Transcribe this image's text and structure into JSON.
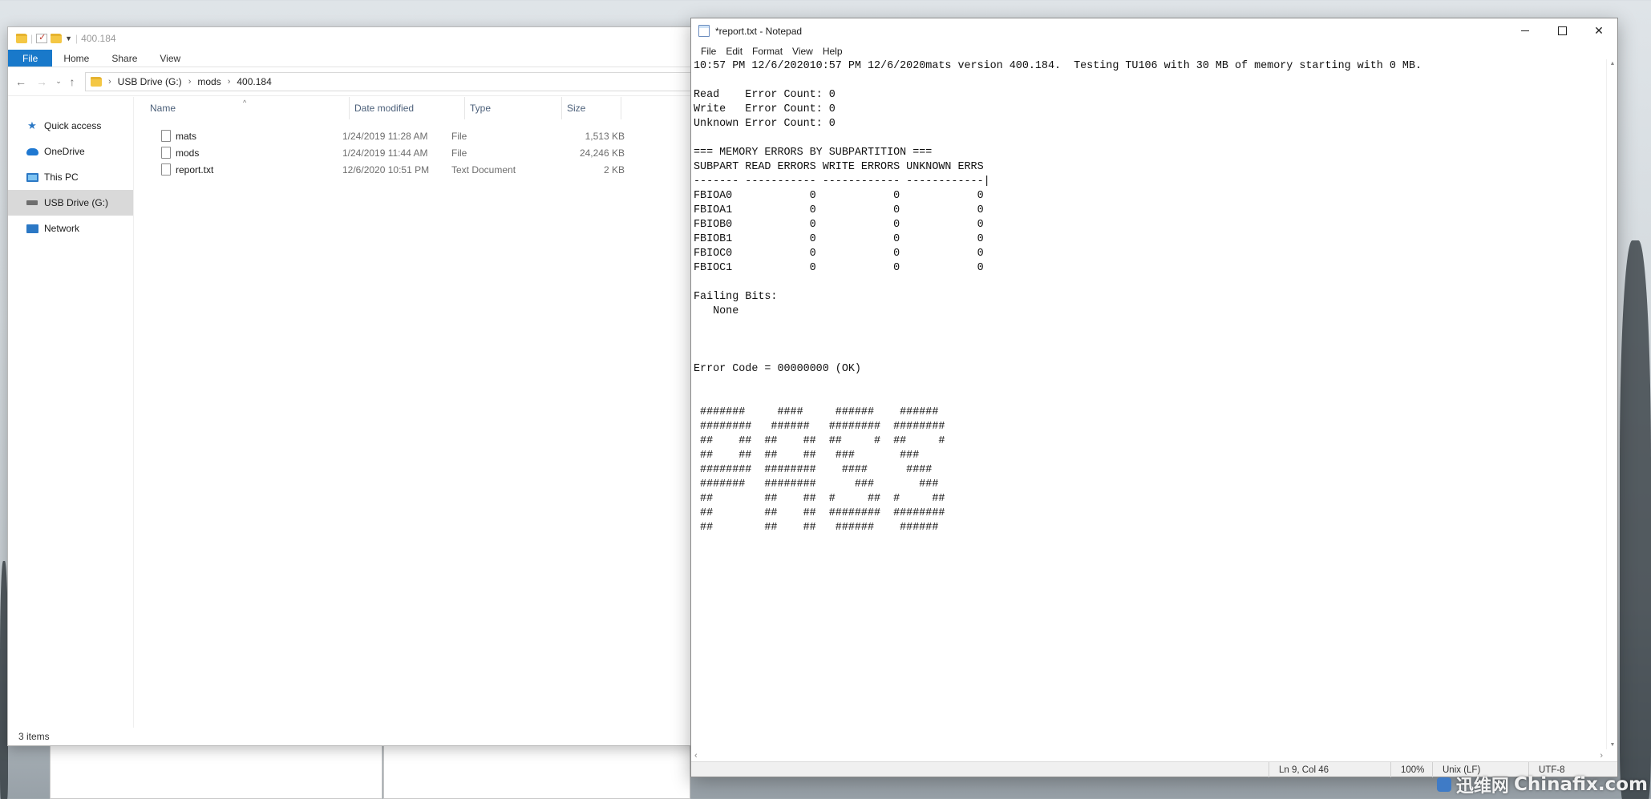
{
  "explorer": {
    "title_path": "400.184",
    "ribbon_tabs": [
      "File",
      "Home",
      "Share",
      "View"
    ],
    "breadcrumb": [
      "USB Drive (G:)",
      "mods",
      "400.184"
    ],
    "nav_items": [
      "Quick access",
      "OneDrive",
      "This PC",
      "USB Drive (G:)",
      "Network"
    ],
    "selected_nav": "USB Drive (G:)",
    "columns": [
      "Name",
      "Date modified",
      "Type",
      "Size"
    ],
    "files": [
      {
        "name": "mats",
        "date": "1/24/2019 11:28 AM",
        "type": "File",
        "size": "1,513 KB"
      },
      {
        "name": "mods",
        "date": "1/24/2019 11:44 AM",
        "type": "File",
        "size": "24,246 KB"
      },
      {
        "name": "report.txt",
        "date": "12/6/2020 10:51 PM",
        "type": "Text Document",
        "size": "2 KB"
      }
    ],
    "status": "3 items"
  },
  "notepad": {
    "title": "*report.txt - Notepad",
    "menu": [
      "File",
      "Edit",
      "Format",
      "View",
      "Help"
    ],
    "content": "10:57 PM 12/6/202010:57 PM 12/6/2020mats version 400.184.  Testing TU106 with 30 MB of memory starting with 0 MB.\n\nRead    Error Count: 0\nWrite   Error Count: 0\nUnknown Error Count: 0\n\n=== MEMORY ERRORS BY SUBPARTITION ===\nSUBPART READ ERRORS WRITE ERRORS UNKNOWN ERRS\n------- ----------- ------------ ------------|\nFBIOA0            0            0            0\nFBIOA1            0            0            0\nFBIOB0            0            0            0\nFBIOB1            0            0            0\nFBIOC0            0            0            0\nFBIOC1            0            0            0\n\nFailing Bits:\n   None\n\n\n\nError Code = 00000000 (OK)\n\n\n #######     ####     ######    ######\n ########   ######   ########  ########\n ##    ##  ##    ##  ##     #  ##     #\n ##    ##  ##    ##   ###       ###\n ########  ########    ####      ####\n #######   ########      ###       ###\n ##        ##    ##  #     ##  #     ##\n ##        ##    ##  ########  ########\n ##        ##    ##   ######    ######",
    "status": {
      "position": "Ln 9, Col 46",
      "zoom": "100%",
      "line_ending": "Unix (LF)",
      "encoding": "UTF-8"
    }
  },
  "watermark": {
    "cn": "迅维网",
    "en": "Chinafix.com"
  }
}
